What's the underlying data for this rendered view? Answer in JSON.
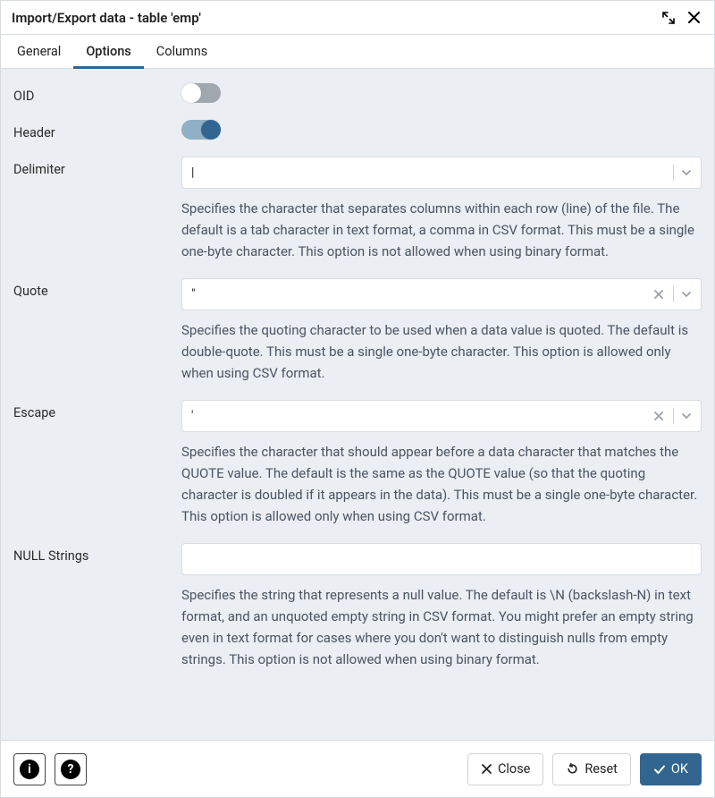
{
  "title": "Import/Export data - table 'emp'",
  "tabs": {
    "general": "General",
    "options": "Options",
    "columns": "Columns"
  },
  "fields": {
    "oid": {
      "label": "OID"
    },
    "header": {
      "label": "Header"
    },
    "delimiter": {
      "label": "Delimiter",
      "value": "|",
      "help": "Specifies the character that separates columns within each row (line) of the file. The default is a tab character in text format, a comma in CSV format. This must be a single one-byte character. This option is not allowed when using binary format."
    },
    "quote": {
      "label": "Quote",
      "value": "\"",
      "help": "Specifies the quoting character to be used when a data value is quoted. The default is double-quote. This must be a single one-byte character. This option is allowed only when using CSV format."
    },
    "escape": {
      "label": "Escape",
      "value": "'",
      "help": "Specifies the character that should appear before a data character that matches the QUOTE value. The default is the same as the QUOTE value (so that the quoting character is doubled if it appears in the data). This must be a single one-byte character. This option is allowed only when using CSV format."
    },
    "null_strings": {
      "label": "NULL Strings",
      "value": "",
      "help": "Specifies the string that represents a null value. The default is \\N (backslash-N) in text format, and an unquoted empty string in CSV format. You might prefer an empty string even in text format for cases where you don't want to distinguish nulls from empty strings. This option is not allowed when using binary format."
    }
  },
  "buttons": {
    "close": "Close",
    "reset": "Reset",
    "ok": "OK"
  }
}
